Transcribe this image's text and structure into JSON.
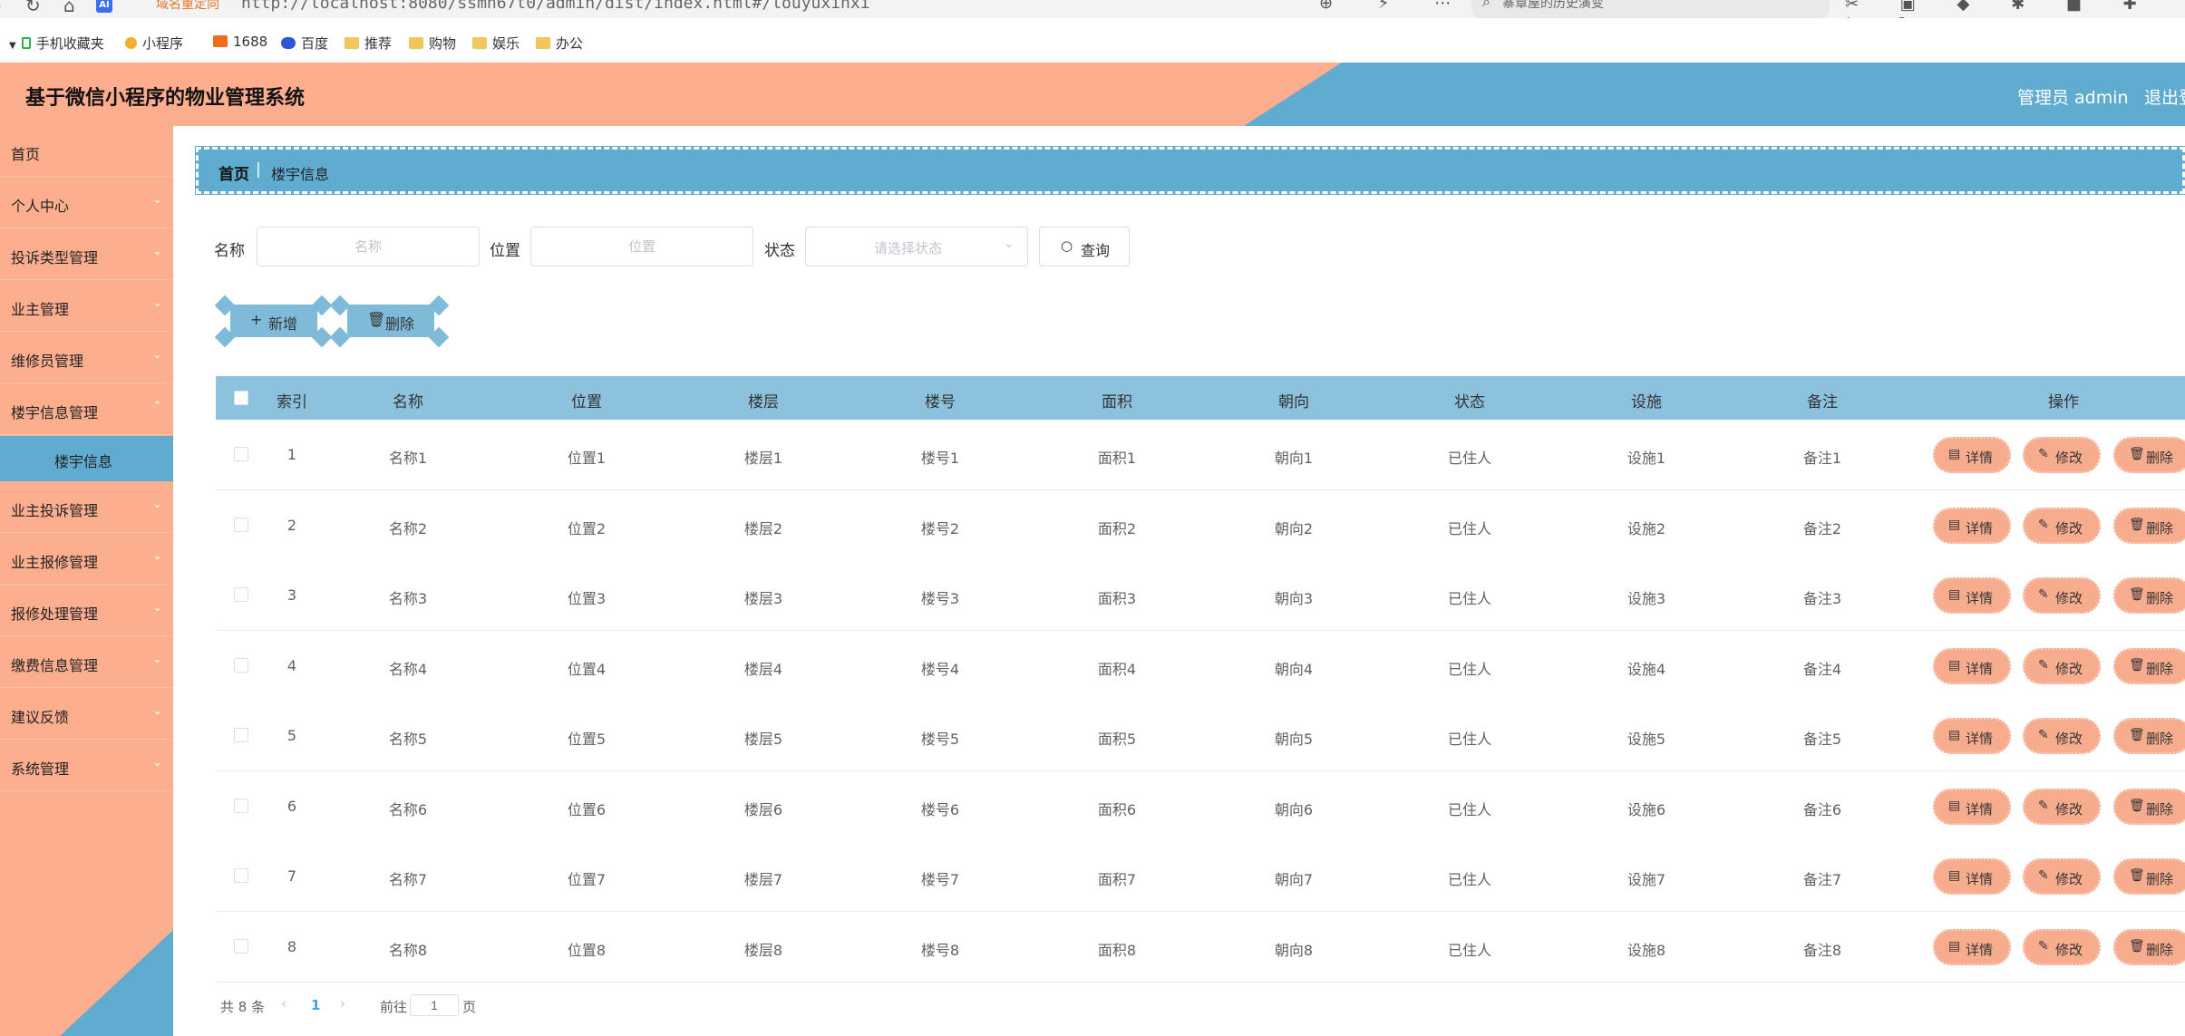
{
  "browser": {
    "redirect_label": "域名重定向",
    "url": "http://localhost:8080/ssmn67t0/admin/dist/index.html#/louyuxinxi",
    "search_placeholder": "寨章屋的历史演变",
    "bookmarks": [
      "手机收藏夹",
      "小程序",
      "1688",
      "百度",
      "推荐",
      "购物",
      "娱乐",
      "办公"
    ]
  },
  "header": {
    "title": "基于微信小程序的物业管理系统",
    "admin": "管理员 admin",
    "logout": "退出登录"
  },
  "sidebar": {
    "items": [
      {
        "label": "首页"
      },
      {
        "label": "个人中心"
      },
      {
        "label": "投诉类型管理"
      },
      {
        "label": "业主管理"
      },
      {
        "label": "维修员管理"
      },
      {
        "label": "楼宇信息管理"
      },
      {
        "label": "楼宇信息"
      },
      {
        "label": "业主投诉管理"
      },
      {
        "label": "业主报修管理"
      },
      {
        "label": "报修处理管理"
      },
      {
        "label": "缴费信息管理"
      },
      {
        "label": "建议反馈"
      },
      {
        "label": "系统管理"
      }
    ]
  },
  "breadcrumb": {
    "home": "首页",
    "separator": "|",
    "current": "楼宇信息"
  },
  "search": {
    "name_label": "名称",
    "name_placeholder": "名称",
    "location_label": "位置",
    "location_placeholder": "位置",
    "status_label": "状态",
    "status_placeholder": "请选择状态",
    "query_button": "查询"
  },
  "actions": {
    "add": "新增",
    "delete": "删除"
  },
  "table": {
    "headers": [
      "索引",
      "名称",
      "位置",
      "楼层",
      "楼号",
      "面积",
      "朝向",
      "状态",
      "设施",
      "备注",
      "操作"
    ],
    "row_buttons": {
      "detail": "详情",
      "edit": "修改",
      "delete": "删除"
    },
    "rows": [
      [
        "1",
        "名称1",
        "位置1",
        "楼层1",
        "楼号1",
        "面积1",
        "朝向1",
        "已住人",
        "设施1",
        "备注1"
      ],
      [
        "2",
        "名称2",
        "位置2",
        "楼层2",
        "楼号2",
        "面积2",
        "朝向2",
        "已住人",
        "设施2",
        "备注2"
      ],
      [
        "3",
        "名称3",
        "位置3",
        "楼层3",
        "楼号3",
        "面积3",
        "朝向3",
        "已住人",
        "设施3",
        "备注3"
      ],
      [
        "4",
        "名称4",
        "位置4",
        "楼层4",
        "楼号4",
        "面积4",
        "朝向4",
        "已住人",
        "设施4",
        "备注4"
      ],
      [
        "5",
        "名称5",
        "位置5",
        "楼层5",
        "楼号5",
        "面积5",
        "朝向5",
        "已住人",
        "设施5",
        "备注5"
      ],
      [
        "6",
        "名称6",
        "位置6",
        "楼层6",
        "楼号6",
        "面积6",
        "朝向6",
        "已住人",
        "设施6",
        "备注6"
      ],
      [
        "7",
        "名称7",
        "位置7",
        "楼层7",
        "楼号7",
        "面积7",
        "朝向7",
        "已住人",
        "设施7",
        "备注7"
      ],
      [
        "8",
        "名称8",
        "位置8",
        "楼层8",
        "楼号8",
        "面积8",
        "朝向8",
        "已住人",
        "设施8",
        "备注8"
      ]
    ]
  },
  "pagination": {
    "total": "共 8 条",
    "current_page": "1",
    "goto_label": "前往",
    "goto_value": "1",
    "page_suffix": "页"
  },
  "colors": {
    "accent_pink": "#fdae8f",
    "accent_blue": "#60acd0",
    "header_blue": "#8cc2dd"
  }
}
